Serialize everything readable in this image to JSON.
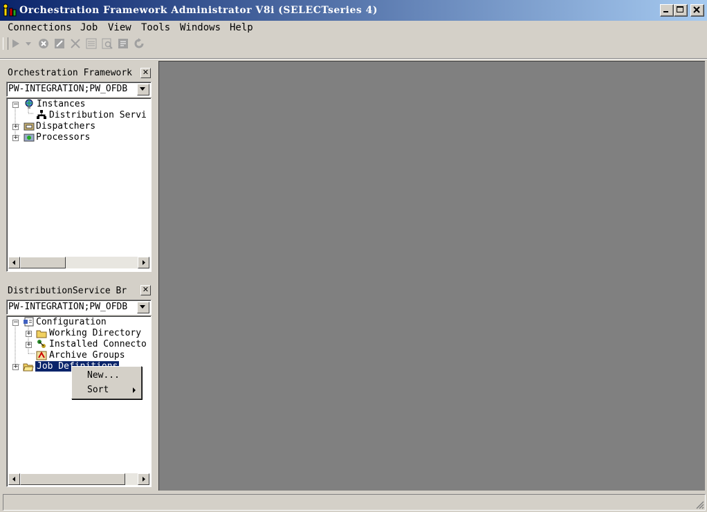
{
  "window": {
    "title": "Orchestration Framework Administrator V8i (SELECTseries 4)"
  },
  "icons": {
    "app": "tools-icon"
  },
  "menu": [
    "Connections",
    "Job",
    "View",
    "Tools",
    "Windows",
    "Help"
  ],
  "toolbar": [
    "run-icon",
    "dropdown-arrow-icon",
    "stop-icon",
    "edit-icon",
    "delete-icon",
    "list-icon",
    "find-icon",
    "report-icon",
    "refresh-icon"
  ],
  "panels": [
    {
      "title": "Orchestration Framework",
      "combo_value": "PW-INTEGRATION;PW_OFDB",
      "tree": [
        {
          "label": "Instances",
          "expander": "−",
          "icon": "globe-icon"
        },
        {
          "label": "Distribution Servi",
          "icon": "network-icon"
        },
        {
          "label": "Dispatchers",
          "expander": "+",
          "icon": "dispatcher-icon"
        },
        {
          "label": "Processors",
          "expander": "+",
          "icon": "processor-icon"
        }
      ]
    },
    {
      "title": "DistributionService Br",
      "combo_value": "PW-INTEGRATION;PW_OFDB",
      "tree": [
        {
          "label": "Configuration",
          "expander": "−",
          "icon": "configuration-icon"
        },
        {
          "label": "Working Directory",
          "expander": "+",
          "icon": "folder-icon"
        },
        {
          "label": "Installed Connecto",
          "expander": "+",
          "icon": "connector-icon"
        },
        {
          "label": "Archive Groups",
          "icon": "archive-icon"
        },
        {
          "label": "Job Definitions",
          "expander": "+",
          "icon": "folder-open-icon",
          "selected": true
        }
      ]
    }
  ],
  "context_menu": {
    "items": [
      "New...",
      "Sort"
    ]
  },
  "status_bar": {
    "text": ""
  }
}
